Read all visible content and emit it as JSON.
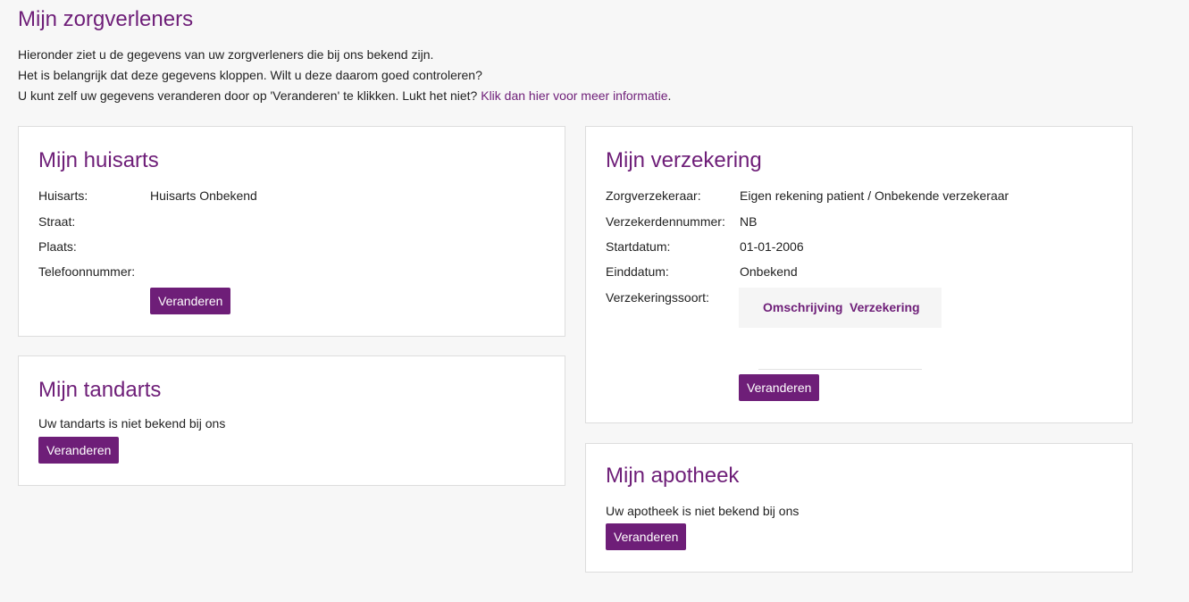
{
  "page": {
    "title": "Mijn zorgverleners",
    "intro_line1": "Hieronder ziet u de gegevens van uw zorgverleners die bij ons bekend zijn.",
    "intro_line2": "Het is belangrijk dat deze gegevens kloppen. Wilt u deze daarom goed controleren?",
    "intro_line3": "U kunt zelf uw gegevens veranderen door op 'Veranderen' te klikken. Lukt het niet?",
    "intro_link": "Klik dan hier voor meer informatie",
    "intro_link_suffix": "."
  },
  "huisarts": {
    "title": "Mijn huisarts",
    "rows": [
      {
        "label": "Huisarts:",
        "value": "Huisarts Onbekend"
      },
      {
        "label": "Straat:",
        "value": ""
      },
      {
        "label": "Plaats:",
        "value": ""
      },
      {
        "label": "Telefoonnummer:",
        "value": ""
      }
    ],
    "button": "Veranderen"
  },
  "tandarts": {
    "title": "Mijn tandarts",
    "text": "Uw tandarts is niet bekend bij ons",
    "button": "Veranderen"
  },
  "verzekering": {
    "title": "Mijn verzekering",
    "rows": [
      {
        "label": "Zorgverzekeraar:",
        "value": "Eigen rekening patient / Onbekende verzekeraar"
      },
      {
        "label": "Verzekerdennummer:",
        "value": "NB"
      },
      {
        "label": "Startdatum:",
        "value": "01-01-2006"
      },
      {
        "label": "Einddatum:",
        "value": "Onbekend"
      },
      {
        "label": "Verzekeringssoort:",
        "value": ""
      }
    ],
    "table_headers": [
      "Omschrijving",
      "Verzekering"
    ],
    "button": "Veranderen"
  },
  "apotheek": {
    "title": "Mijn apotheek",
    "text": "Uw apotheek is niet bekend bij ons",
    "button": "Veranderen"
  },
  "colors": {
    "accent": "#6e1e78",
    "background": "#f7f7f7",
    "card_border": "#dddddd"
  }
}
